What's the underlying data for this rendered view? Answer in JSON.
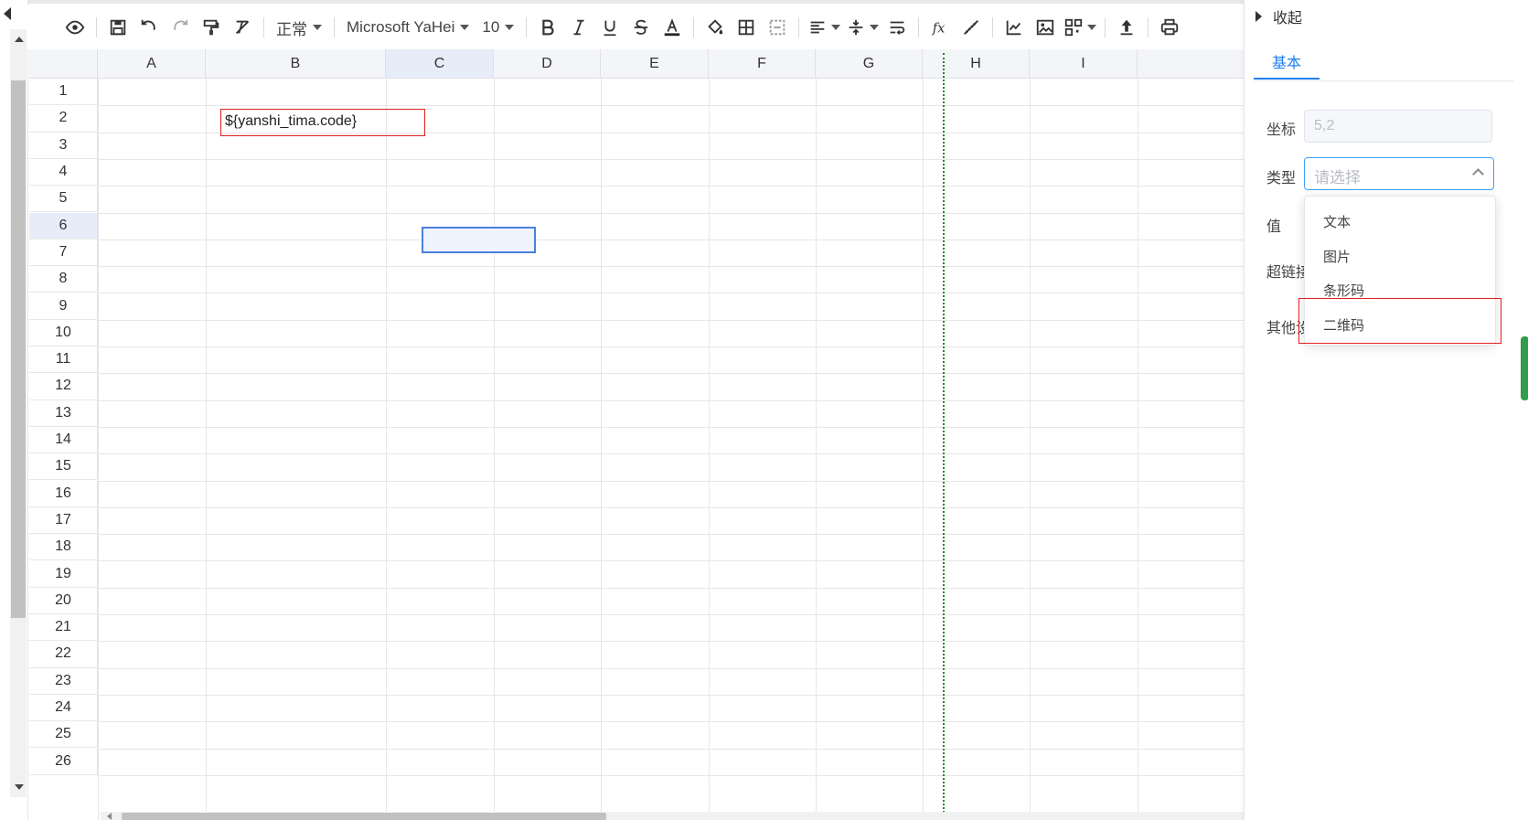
{
  "toolbar": {
    "style_select": "正常",
    "font_select": "Microsoft YaHei",
    "size_select": "10"
  },
  "grid": {
    "columns": [
      "A",
      "B",
      "C",
      "D",
      "E",
      "F",
      "G",
      "H",
      "I"
    ],
    "rows": [
      "1",
      "2",
      "3",
      "4",
      "5",
      "6",
      "7",
      "8",
      "9",
      "10",
      "11",
      "12",
      "13",
      "14",
      "15",
      "16",
      "17",
      "18",
      "19",
      "20",
      "21",
      "22",
      "23",
      "24",
      "25",
      "26"
    ],
    "active_column": "C",
    "active_row": "6",
    "cell_b2_text": "${yanshi_tima.code}"
  },
  "panel": {
    "collapse_label": "收起",
    "tab_basic": "基本",
    "coord_label": "坐标",
    "coord_value": "5,2",
    "type_label": "类型",
    "type_placeholder": "请选择",
    "value_label": "值",
    "hyperlink_label": "超链接",
    "other_label": "其他设",
    "options": [
      "文本",
      "图片",
      "条形码",
      "二维码"
    ]
  },
  "colors": {
    "accent": "#1f7ff0",
    "highlight": "#e02020",
    "selection": "#4a7fe0"
  }
}
